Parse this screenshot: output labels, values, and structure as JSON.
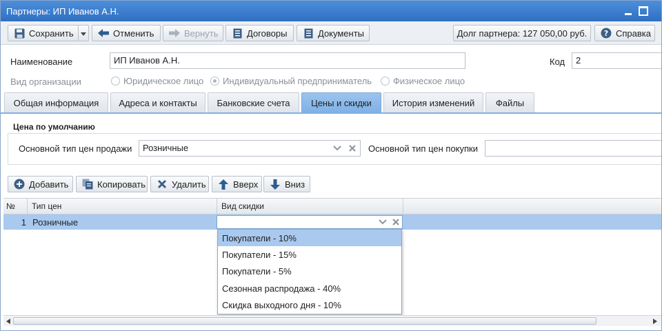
{
  "window": {
    "title": "Партнеры: ИП Иванов А.Н."
  },
  "toolbar": {
    "save": "Сохранить",
    "undo": "Отменить",
    "redo": "Вернуть",
    "contracts": "Договоры",
    "documents": "Документы",
    "debt": "Долг партнера: 127 050,00 руб.",
    "help": "Справка"
  },
  "form": {
    "name_label": "Наименование",
    "name_value": "ИП Иванов А.Н.",
    "code_label": "Код",
    "code_value": "2",
    "org_type_label": "Вид организации",
    "org_types": [
      "Юридическое лицо",
      "Индивидуальный предприниматель",
      "Физическое лицо"
    ],
    "org_type_selected": "Индивидуальный предприниматель"
  },
  "tabs": [
    "Общая информация",
    "Адреса и контакты",
    "Банковские счета",
    "Цены и скидки",
    "История изменений",
    "Файлы"
  ],
  "active_tab": "Цены и скидки",
  "prices": {
    "section_title": "Цена по умолчанию",
    "sale_label": "Основной тип цен продажи",
    "sale_value": "Розничные",
    "purchase_label": "Основной тип цен покупки",
    "purchase_value": ""
  },
  "grid_toolbar": {
    "add": "Добавить",
    "copy": "Копировать",
    "delete": "Удалить",
    "up": "Вверх",
    "down": "Вниз"
  },
  "grid": {
    "columns": [
      "№",
      "Тип цен",
      "Вид скидки"
    ],
    "rows": [
      {
        "num": "1",
        "price_type": "Розничные",
        "discount": ""
      }
    ]
  },
  "dropdown": {
    "options": [
      "Покупатели - 10%",
      "Покупатели - 15%",
      "Покупатели - 5%",
      "Сезонная распродажа - 40%",
      "Скидка выходного дня - 10%"
    ],
    "highlighted": "Покупатели - 10%"
  },
  "colors": {
    "title_bar": "#3a7fd0",
    "active_tab": "#8fbbea",
    "selection": "#a9c9ef"
  }
}
